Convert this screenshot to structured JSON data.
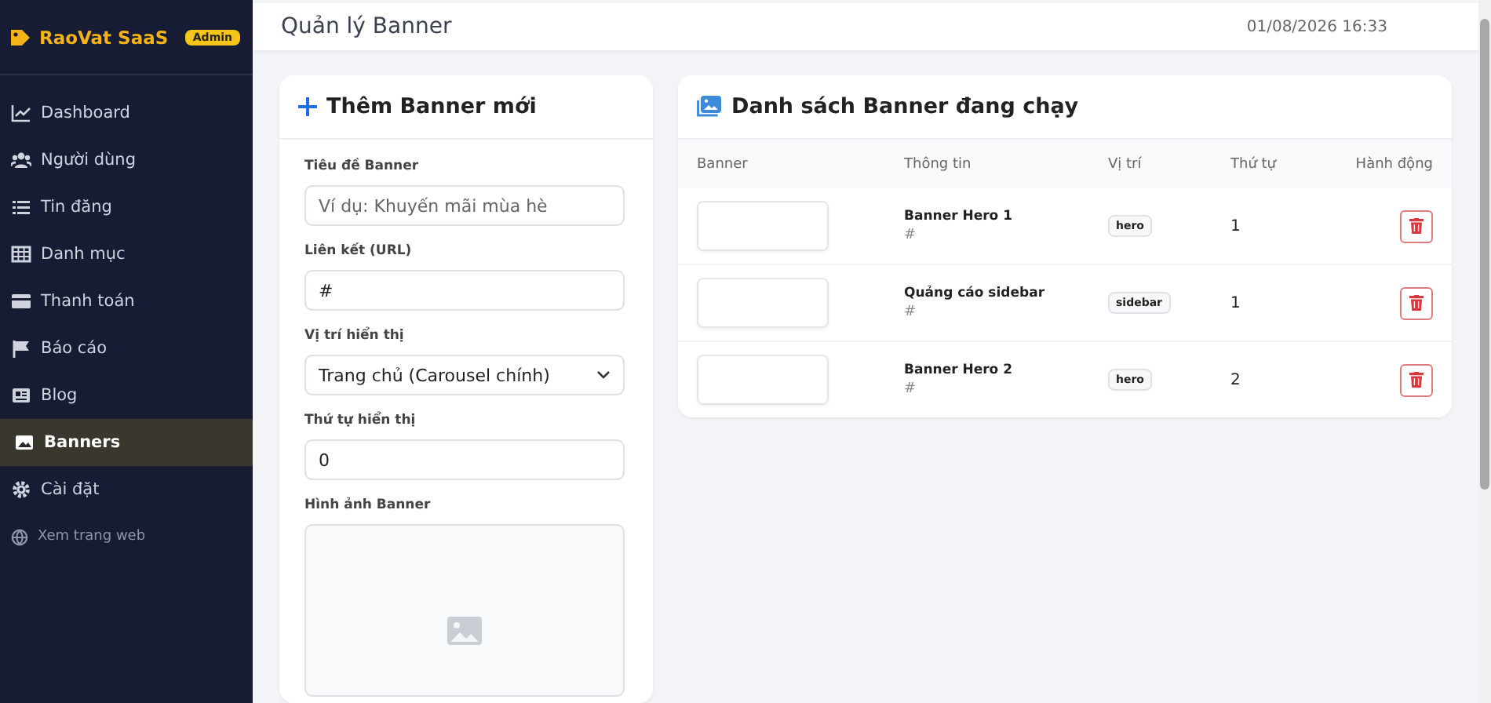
{
  "sidebar": {
    "brand": "RaoVat SaaS",
    "badge": "Admin",
    "items": [
      {
        "label": "Dashboard",
        "selected": false
      },
      {
        "label": "Người dùng",
        "selected": false
      },
      {
        "label": "Tin đăng",
        "selected": false
      },
      {
        "label": "Danh mục",
        "selected": false
      },
      {
        "label": "Thanh toán",
        "selected": false
      },
      {
        "label": "Báo cáo",
        "selected": false
      },
      {
        "label": "Blog",
        "selected": false
      },
      {
        "label": "Banners",
        "selected": true
      },
      {
        "label": "Cài đặt",
        "selected": false
      }
    ],
    "footer_link": "Xem trang web"
  },
  "header": {
    "title": "Quản lý Banner",
    "datetime": "01/08/2026 16:33"
  },
  "form": {
    "title": "Thêm Banner mới",
    "fields": [
      {
        "kind": "text",
        "label": "Tiêu đề Banner",
        "placeholder": "Ví dụ: Khuyến mãi mùa hè"
      },
      {
        "kind": "text",
        "label": "Liên kết (URL)",
        "value": "#"
      },
      {
        "kind": "select",
        "label": "Vị trí hiển thị",
        "value": "Trang chủ (Carousel chính)"
      },
      {
        "kind": "text",
        "label": "Thứ tự hiển thị",
        "value": "0"
      },
      {
        "kind": "upload",
        "label": "Hình ảnh Banner"
      }
    ]
  },
  "list": {
    "title": "Danh sách Banner đang chạy",
    "columns": [
      "Banner",
      "Thông tin",
      "Vị trí",
      "Thứ tự",
      "Hành động"
    ],
    "rows": [
      {
        "name": "Banner Hero 1",
        "link": "#",
        "position": "hero",
        "order": "1"
      },
      {
        "name": "Quảng cáo sidebar",
        "link": "#",
        "position": "sidebar",
        "order": "1"
      },
      {
        "name": "Banner Hero 2",
        "link": "#",
        "position": "hero",
        "order": "2"
      }
    ]
  }
}
